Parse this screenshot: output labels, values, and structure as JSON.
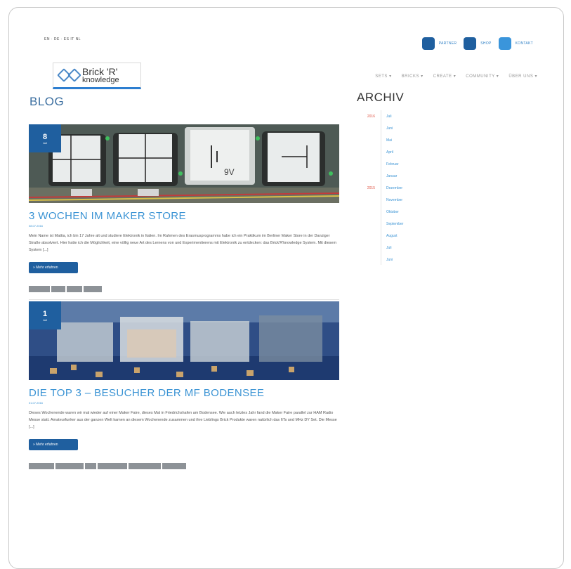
{
  "topbar": {
    "languages": "EN · DE · ES IT NL",
    "buttons": [
      {
        "label": "PARTNER",
        "icon": "partner-square-icon"
      },
      {
        "label": "SHOP",
        "icon": "shop-square-icon"
      },
      {
        "label": "KONTAKT",
        "icon": "kontakt-square-icon"
      }
    ]
  },
  "logo": {
    "line1": "Brick 'R'",
    "line2": "knowledge"
  },
  "nav": [
    "SETS ▾",
    "BRICKS ▾",
    "CREATE ▾",
    "COMMUNITY ▾",
    "ÜBER UNS ▾"
  ],
  "blog": {
    "title": "BLOG",
    "posts": [
      {
        "day": "8",
        "month": "Juli",
        "title": "3 WOCHEN IM MAKER STORE",
        "date": "08.07.2016",
        "text": "Mein Name ist Mattia, ich bin 17 Jahre alt und studiere Elektronik in Italien. Im Rahmen des Erasmusprogramms habe ich ein Praktikum im Berliner Maker Store in der Danziger Straße absolviert. Hier hatte ich die Möglichkeit, eine völlig neue Art des Lernens von und Experimentierens mit Elektronik zu entdecken: das Brick'R'knowledge System. Mit diesem System [...]",
        "more": "» Mehr erfahren"
      },
      {
        "day": "1",
        "month": "Juli",
        "title": "DIE TOP 3 – BESUCHER DER MF BODENSEE",
        "date": "01.07.2016",
        "text": "Dieses Wochenende waren wir mal wieder auf einer Maker Faire, dieses Mal in Friedrichshafen am Bodensee. Wie auch letztes Jahr fand die Maker Faire parallel zur HAM Radio Messe statt. Amateurfunker aus der ganzen Welt kamen an diesem Wochenende zusammen und ihre Lieblings Brick Produkte waren natürlich das 6Ts und MHz DY Set. Die Messe [...]",
        "more": "» Mehr erfahren"
      }
    ]
  },
  "archive": {
    "title": "ARCHIV",
    "rows": [
      {
        "year": "2016",
        "month": "Juli"
      },
      {
        "year": "",
        "month": "Juni"
      },
      {
        "year": "",
        "month": "Mai"
      },
      {
        "year": "",
        "month": "April"
      },
      {
        "year": "",
        "month": "Februar"
      },
      {
        "year": "",
        "month": "Januar"
      },
      {
        "year": "2015",
        "month": "Dezember"
      },
      {
        "year": "",
        "month": "November"
      },
      {
        "year": "",
        "month": "Oktober"
      },
      {
        "year": "",
        "month": "September"
      },
      {
        "year": "",
        "month": "August"
      },
      {
        "year": "",
        "month": "Juli"
      },
      {
        "year": "",
        "month": "Juni"
      }
    ]
  },
  "colors": {
    "accent": "#1f5f9f",
    "link": "#3a93d4",
    "year": "#e05a4a"
  }
}
